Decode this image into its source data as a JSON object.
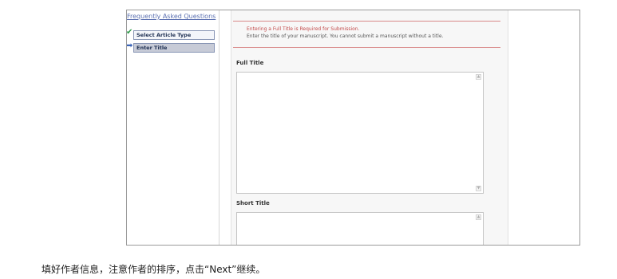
{
  "sidebar": {
    "faq_link": "Frequently Asked Questions",
    "steps": [
      {
        "label": "Select Article Type",
        "status": "completed",
        "marker": "check-icon"
      },
      {
        "label": "Enter Title",
        "status": "current",
        "marker": "arrow-right-icon"
      }
    ]
  },
  "notice": {
    "title": "Entering a Full Title is Required for Submission.",
    "text": "Enter the title of your manuscript. You cannot submit a manuscript without a title."
  },
  "fields": {
    "full_title": {
      "label": "Full Title",
      "value": ""
    },
    "short_title": {
      "label": "Short Title",
      "value": ""
    }
  },
  "caption": "填好作者信息，注意作者的排序，点击“Next”继续。",
  "colors": {
    "accent_red": "#c34b4b",
    "link_blue": "#5a6fb0",
    "current_step_bg": "#c7cbd7",
    "check_green": "#2f9a4a"
  }
}
